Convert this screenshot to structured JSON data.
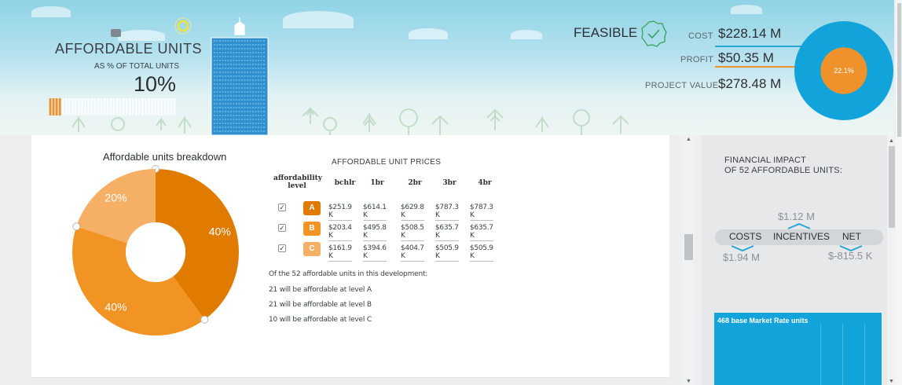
{
  "header": {
    "affordable_title": "AFFORDABLE UNITS",
    "affordable_sub": "AS % OF TOTAL UNITS",
    "affordable_pct": "10%",
    "affordable_fraction": 0.1,
    "feasible_label": "FEASIBLE",
    "cost_label": "COST",
    "cost_value": "$228.14 M",
    "profit_label": "PROFIT",
    "profit_value": "$50.35 M",
    "project_value_label": "PROJECT VALUE",
    "project_value": "$278.48 M",
    "profit_pct": "22.1%",
    "profit_fraction": 0.221
  },
  "breakdown": {
    "title": "Affordable units breakdown",
    "slices": [
      {
        "label": "40%",
        "value": 40,
        "color": "#e07b00"
      },
      {
        "label": "40%",
        "value": 40,
        "color": "#f29423"
      },
      {
        "label": "20%",
        "value": 20,
        "color": "#f5b066"
      }
    ]
  },
  "prices": {
    "title": "AFFORDABLE UNIT PRICES",
    "level_header": "affordability level",
    "columns": [
      "bchlr",
      "1br",
      "2br",
      "3br",
      "4br"
    ],
    "rows": [
      {
        "level": "A",
        "checked": true,
        "color": "#e07b00",
        "prices": [
          "$251.9 K",
          "$614.1 K",
          "$629.8 K",
          "$787.3 K",
          "$787.3 K"
        ]
      },
      {
        "level": "B",
        "checked": true,
        "color": "#f29423",
        "prices": [
          "$203.4 K",
          "$495.8 K",
          "$508.5 K",
          "$635.7 K",
          "$635.7 K"
        ]
      },
      {
        "level": "C",
        "checked": true,
        "color": "#f5b066",
        "prices": [
          "$161.9 K",
          "$394.6 K",
          "$404.7 K",
          "$505.9 K",
          "$505.9 K"
        ]
      }
    ],
    "notes": [
      "Of the 52 affordable units in this development:",
      "21 will be affordable at level A",
      "21 will be affordable at level B",
      "10 will be affordable at level C"
    ]
  },
  "impact": {
    "title_line1": "FINANCIAL IMPACT",
    "title_line2": "OF 52 AFFORDABLE UNITS:",
    "incentives_value": "$1.12 M",
    "costs_label": "COSTS",
    "incentives_label": "INCENTIVES",
    "net_label": "NET",
    "costs_value": "$1.94 M",
    "net_value": "$-815.5 K",
    "market_label": "468 base Market Rate units"
  },
  "colors": {
    "accent_blue": "#11a3d9",
    "accent_orange": "#f0922b",
    "feasible_green": "#3aa35a"
  }
}
